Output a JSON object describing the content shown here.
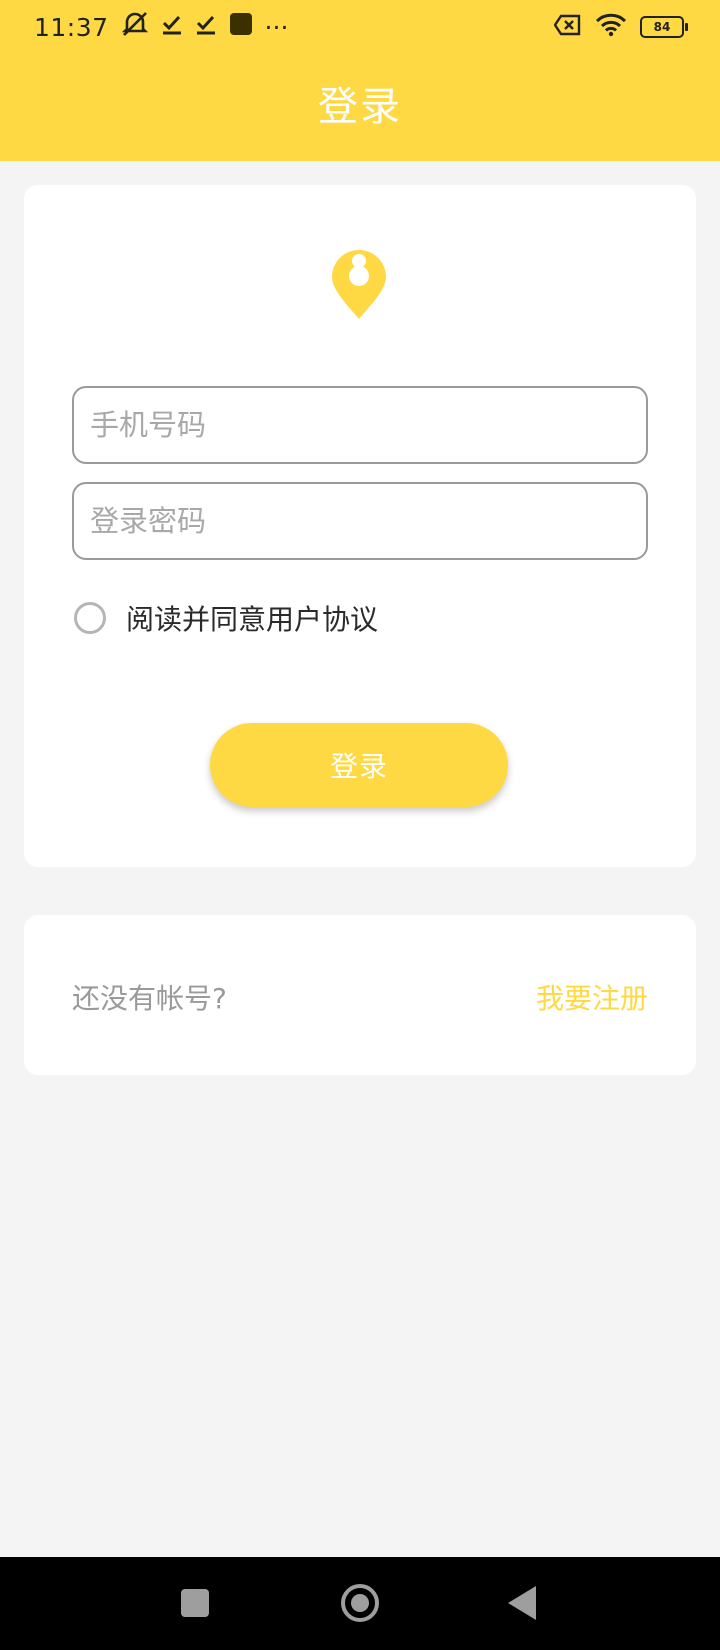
{
  "colors": {
    "brand": "#ffd944",
    "background": "#f4f4f4",
    "card": "#ffffff",
    "placeholder": "#a8a8a8",
    "nav_bar": "#000000"
  },
  "status_bar": {
    "time": "11:37",
    "dots": "···",
    "battery_level": "84",
    "icons": [
      "mute-icon",
      "check-icon",
      "check-icon",
      "app-square-icon",
      "sim-error-icon",
      "wifi-icon",
      "battery-icon"
    ]
  },
  "header": {
    "title": "登录"
  },
  "login_form": {
    "logo_icon": "map-pin-icon",
    "phone_placeholder": "手机号码",
    "password_placeholder": "登录密码",
    "agreement_label": "阅读并同意用户协议",
    "login_button_label": "登录"
  },
  "register": {
    "prompt": "还没有帐号?",
    "link_label": "我要注册"
  },
  "nav_bar": {
    "icons": [
      "recent-apps-icon",
      "home-icon",
      "back-icon"
    ]
  }
}
